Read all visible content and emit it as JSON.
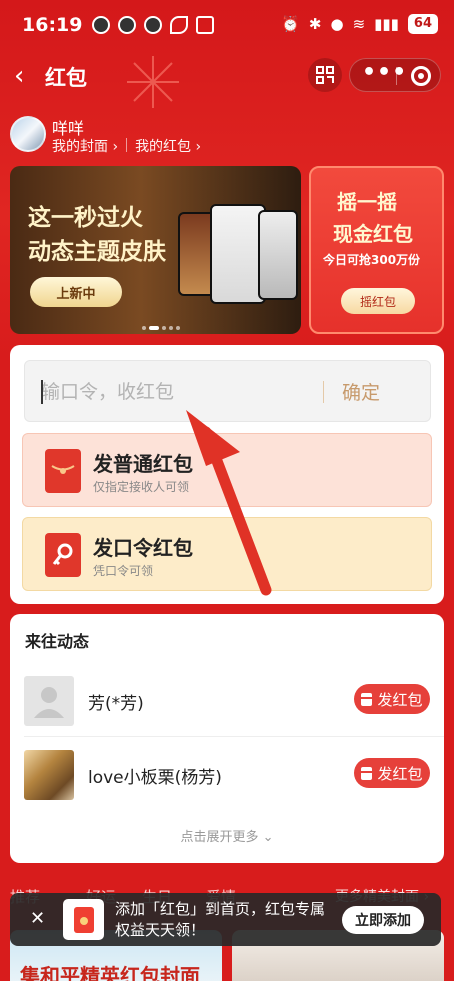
{
  "status_bar": {
    "time": "16:19",
    "battery": "64"
  },
  "header": {
    "back_icon": "chevron-left-icon",
    "title": "红包"
  },
  "user": {
    "name": "咩咩",
    "my_cover": "我的封面",
    "my_redpacket": "我的红包"
  },
  "banners": {
    "main": {
      "line1": "这一秒过火",
      "line2": "动态主题皮肤",
      "button": "上新中"
    },
    "side": {
      "line1": "摇一摇",
      "line2": "现金红包",
      "line3": "今日可抢300万份",
      "button": "摇红包"
    }
  },
  "token": {
    "placeholder": "输口令，收红包",
    "confirm": "确定"
  },
  "actions": [
    {
      "title": "发普通红包",
      "subtitle": "仅指定接收人可领"
    },
    {
      "title": "发口令红包",
      "subtitle": "凭口令可领"
    }
  ],
  "contacts": {
    "title": "来往动态",
    "items": [
      {
        "name": "芳(*芳)",
        "button": "发红包"
      },
      {
        "name": "love小板栗(杨芳)",
        "button": "发红包"
      }
    ],
    "expand": "点击展开更多"
  },
  "bottom": {
    "tabs": [
      "推荐",
      "好运",
      "生日",
      "爱情"
    ],
    "more": "更多精美封面",
    "cover_text": "集和平精英红包封面"
  },
  "toast": {
    "text": "添加「红包」到首页，红包专属权益天天领！",
    "button": "立即添加"
  },
  "colors": {
    "primary_red": "#d81c1c",
    "send_button": "#e6403a",
    "confirm_text": "#c79a6c"
  }
}
